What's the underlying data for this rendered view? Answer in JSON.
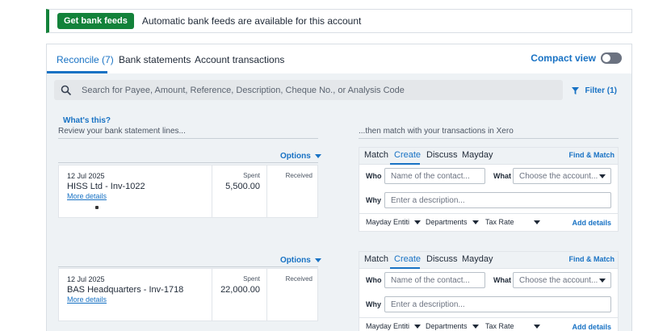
{
  "banner": {
    "button_label": "Get bank feeds",
    "text": "Automatic bank feeds are available for this account"
  },
  "tabs": [
    {
      "label": "Reconcile (7)",
      "active": true
    },
    {
      "label": "Bank statements",
      "active": false
    },
    {
      "label": "Account transactions",
      "active": false
    }
  ],
  "compact_view": {
    "label": "Compact view",
    "enabled": false
  },
  "search": {
    "placeholder": "Search for Payee, Amount, Reference, Description, Cheque No., or Analysis Code"
  },
  "filter": {
    "label": "Filter (1)"
  },
  "help": {
    "whats_this": "What's this?",
    "review": "Review your bank statement lines...",
    "then_match": "...then match with your transactions in Xero"
  },
  "lines": [
    {
      "options_label": "Options",
      "date": "12 Jul 2025",
      "reference": "HISS Ltd - Inv-1022",
      "more_details": "More details",
      "spent_label": "Spent",
      "spent": "5,500.00",
      "received_label": "Received",
      "received": "",
      "match_tabs": [
        "Match",
        "Create",
        "Discuss",
        "Mayday"
      ],
      "active_tab": "Create",
      "find_match": "Find & Match",
      "who_label": "Who",
      "who_placeholder": "Name of the contact...",
      "what_label": "What",
      "what_placeholder": "Choose the account...",
      "why_label": "Why",
      "why_placeholder": "Enter a description...",
      "tracking": [
        "Mayday Entiti",
        "Departments",
        "Tax Rate"
      ],
      "add_details": "Add details"
    },
    {
      "options_label": "Options",
      "date": "12 Jul 2025",
      "reference": "BAS Headquarters - Inv-1718",
      "more_details": "More details",
      "spent_label": "Spent",
      "spent": "22,000.00",
      "received_label": "Received",
      "received": "",
      "match_tabs": [
        "Match",
        "Create",
        "Discuss",
        "Mayday"
      ],
      "active_tab": "Create",
      "find_match": "Find & Match",
      "who_label": "Who",
      "who_placeholder": "Name of the contact...",
      "what_label": "What",
      "what_placeholder": "Choose the account...",
      "why_label": "Why",
      "why_placeholder": "Enter a description...",
      "tracking": [
        "Mayday Entiti",
        "Departments",
        "Tax Rate"
      ],
      "add_details": "Add details"
    }
  ],
  "colors": {
    "accent": "#1872c4",
    "brand_green": "#13823a",
    "panel_bg": "#eef2f5"
  }
}
